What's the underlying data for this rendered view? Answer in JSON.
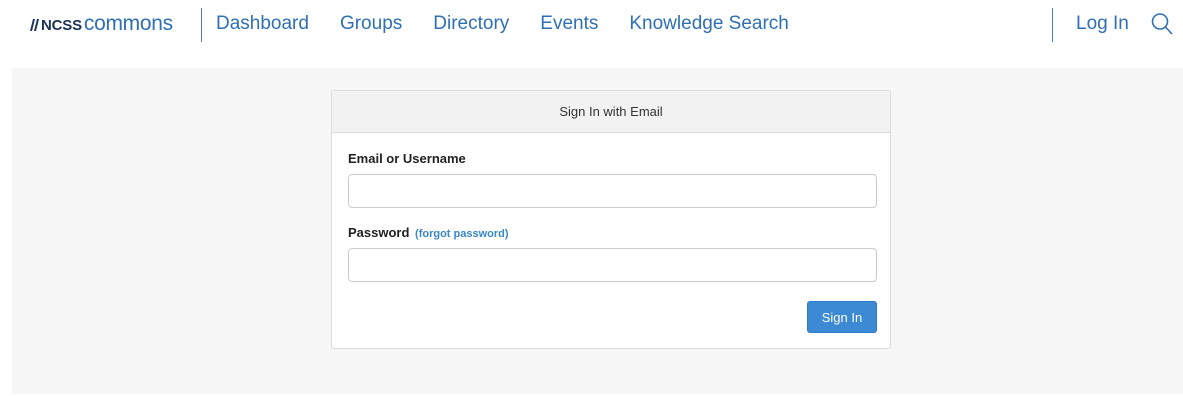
{
  "brand": {
    "logo_bold": "NCSS",
    "logo_light": "commons"
  },
  "nav": {
    "items": [
      {
        "label": "Dashboard"
      },
      {
        "label": "Groups"
      },
      {
        "label": "Directory"
      },
      {
        "label": "Events"
      },
      {
        "label": "Knowledge Search"
      }
    ],
    "login_label": "Log In",
    "search_icon": "search-icon"
  },
  "signin_panel": {
    "header": "Sign In with Email",
    "email_label": "Email or Username",
    "email_value": "",
    "password_label": "Password",
    "forgot_label": "(forgot password)",
    "password_value": "",
    "submit_label": "Sign In"
  },
  "colors": {
    "link_blue": "#2f6fb4",
    "button_blue": "#3b8ad3",
    "logo_navy": "#1b3358"
  }
}
